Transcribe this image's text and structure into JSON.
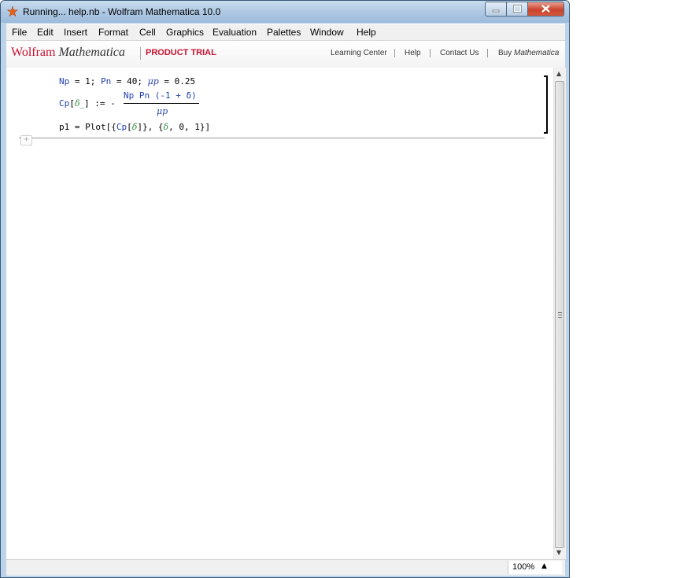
{
  "window": {
    "title": "Running... help.nb - Wolfram Mathematica 10.0"
  },
  "menu": [
    "File",
    "Edit",
    "Insert",
    "Format",
    "Cell",
    "Graphics",
    "Evaluation",
    "Palettes",
    "Window",
    "Help"
  ],
  "brand": {
    "name_wolfram": "Wolfram",
    "name_mathematica": "Mathematica",
    "trial": "PRODUCT TRIAL",
    "links": {
      "learning_center": "Learning Center",
      "help": "Help",
      "contact_us": "Contact Us",
      "buy_prefix": "Buy",
      "buy_mathematica": "Mathematica"
    }
  },
  "notebook": {
    "line1": {
      "np": "Np",
      "eq1": " = 1; ",
      "pn": "Pn",
      "eq2": " = 40; ",
      "mu": "μp",
      "eq3": " = 0.25"
    },
    "line2": {
      "cp": "Cp",
      "open": "[",
      "delta": "δ_",
      "close": "] := -",
      "numerator": "Np Pn (-1 + δ)",
      "denominator": "μp"
    },
    "line3": {
      "p1": "p1",
      "eq": " = Plot[{",
      "cp": "Cp",
      "bracket": "[",
      "delta": "δ",
      "rest1": "]}, {",
      "delta2": "δ",
      "rest2": ", 0, 1}]"
    }
  },
  "status": {
    "zoom": "100%"
  },
  "colors": {
    "symbol_blue": "#1f3fb3",
    "pattern_green": "#2a8a3a",
    "brand_red": "#c8102e"
  }
}
